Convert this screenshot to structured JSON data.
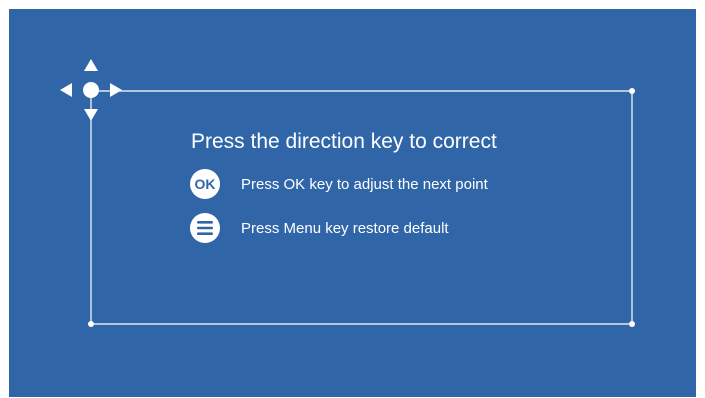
{
  "colors": {
    "background": "#3066a8",
    "foreground": "#ffffff"
  },
  "instructions": {
    "title": "Press the direction key to correct",
    "ok_badge": "OK",
    "ok_text": "Press OK key to adjust the next point",
    "menu_text": "Press Menu key restore default"
  },
  "icons": {
    "direction_pad": "direction-pad-icon",
    "menu": "menu-icon"
  },
  "corner_points": [
    "top-left",
    "top-right",
    "bottom-left",
    "bottom-right"
  ]
}
